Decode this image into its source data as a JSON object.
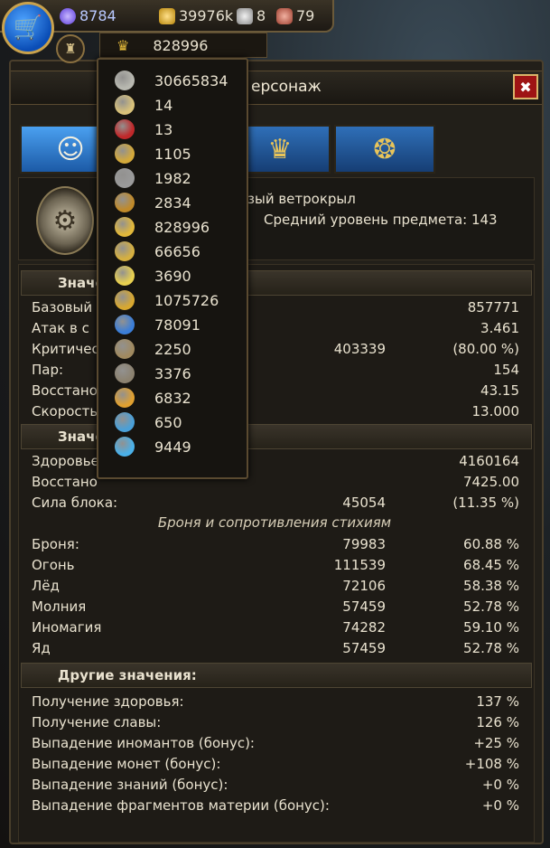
{
  "topbar": {
    "shop_icon": "cart-icon",
    "gems": "8784",
    "gold": "39976k",
    "silver": "8",
    "meat": "79",
    "crown_value": "828996"
  },
  "window": {
    "title": "ерсонаж",
    "close_label": "✖"
  },
  "tabs": [
    {
      "name": "character",
      "icon": "person-icon",
      "glyph": "☺"
    },
    {
      "name": "achievements",
      "icon": "star-icon",
      "glyph": "★"
    },
    {
      "name": "royalty",
      "icon": "crown-icon",
      "glyph": "♛"
    },
    {
      "name": "guild",
      "icon": "lion-icon",
      "glyph": "❂"
    }
  ],
  "character": {
    "name_fragment": "зый ветрокрыл",
    "avg_item_level": "Средний уровень предмета: 143"
  },
  "currency_popup": [
    {
      "icon": "feather-icon",
      "color": "#b8b8b0",
      "value": "30665834"
    },
    {
      "icon": "silver-coin-icon",
      "color": "#d9c27a",
      "value": "14"
    },
    {
      "icon": "red-gem-icon",
      "color": "#c0282a",
      "value": "13"
    },
    {
      "icon": "gold-coin-icon",
      "color": "#d4a93a",
      "value": "1105"
    },
    {
      "icon": "gray-coin-icon",
      "color": "#9a9a9a",
      "value": "1982"
    },
    {
      "icon": "amber-coin-icon",
      "color": "#c08a2a",
      "value": "2834"
    },
    {
      "icon": "crown-icon",
      "color": "#e2b83a",
      "value": "828996"
    },
    {
      "icon": "fruit-icon",
      "color": "#d6b040",
      "value": "66656"
    },
    {
      "icon": "clover-icon",
      "color": "#e8d050",
      "value": "3690"
    },
    {
      "icon": "gold-block-icon",
      "color": "#d8a830",
      "value": "1075726"
    },
    {
      "icon": "blue-crystal-icon",
      "color": "#3b7ed8",
      "value": "78091"
    },
    {
      "icon": "ore-icon",
      "color": "#a08a60",
      "value": "2250"
    },
    {
      "icon": "web-icon",
      "color": "#8c8270",
      "value": "3376"
    },
    {
      "icon": "sun-coin-icon",
      "color": "#e0a030",
      "value": "6832"
    },
    {
      "icon": "ice-orb-icon",
      "color": "#4aa0d8",
      "value": "650"
    },
    {
      "icon": "star-medal-icon",
      "color": "#4ab0e8",
      "value": "9449"
    }
  ],
  "sections": {
    "s1": "Значе",
    "s2": "Значе",
    "s3": "Другие значения:",
    "armor_sub": "Броня и сопротивления стихиям"
  },
  "rows1": [
    {
      "label": "Базовый",
      "v1": "",
      "v2": "857771"
    },
    {
      "label": "Атак в с",
      "v1": "",
      "v2": "3.461"
    },
    {
      "label": "Критичес",
      "v1": "403339",
      "v2": "(80.00 %)"
    },
    {
      "label": "Пар:",
      "v1": "",
      "v2": "154"
    },
    {
      "label": "Восстано",
      "v1": "",
      "v2": "43.15"
    },
    {
      "label": "Скорость",
      "v1": "",
      "v2": "13.000"
    }
  ],
  "rows2": [
    {
      "label": "Здоровье",
      "v1": "",
      "v2": "4160164"
    },
    {
      "label": "Восстано",
      "v1": "",
      "v2": "7425.00"
    },
    {
      "label": "Сила блока:",
      "v1": "45054",
      "v2": "(11.35 %)"
    }
  ],
  "rows_armor": [
    {
      "label": "Броня:",
      "v1": "79983",
      "v2": "60.88 %"
    },
    {
      "label": "Огонь",
      "v1": "111539",
      "v2": "68.45 %"
    },
    {
      "label": "Лёд",
      "v1": "72106",
      "v2": "58.38 %"
    },
    {
      "label": "Молния",
      "v1": "57459",
      "v2": "52.78 %"
    },
    {
      "label": "Иномагия",
      "v1": "74282",
      "v2": "59.10 %"
    },
    {
      "label": "Яд",
      "v1": "57459",
      "v2": "52.78 %"
    }
  ],
  "rows_other": [
    {
      "label": "Получение здоровья:",
      "v2": "137 %"
    },
    {
      "label": "Получение славы:",
      "v2": "126 %"
    },
    {
      "label": "Выпадение иномантов (бонус):",
      "v2": "+25 %"
    },
    {
      "label": "Выпадение монет (бонус):",
      "v2": "+108 %"
    },
    {
      "label": "Выпадение знаний (бонус):",
      "v2": "+0 %"
    },
    {
      "label": "Выпадение фрагментов материи (бонус):",
      "v2": "+0 %"
    }
  ]
}
